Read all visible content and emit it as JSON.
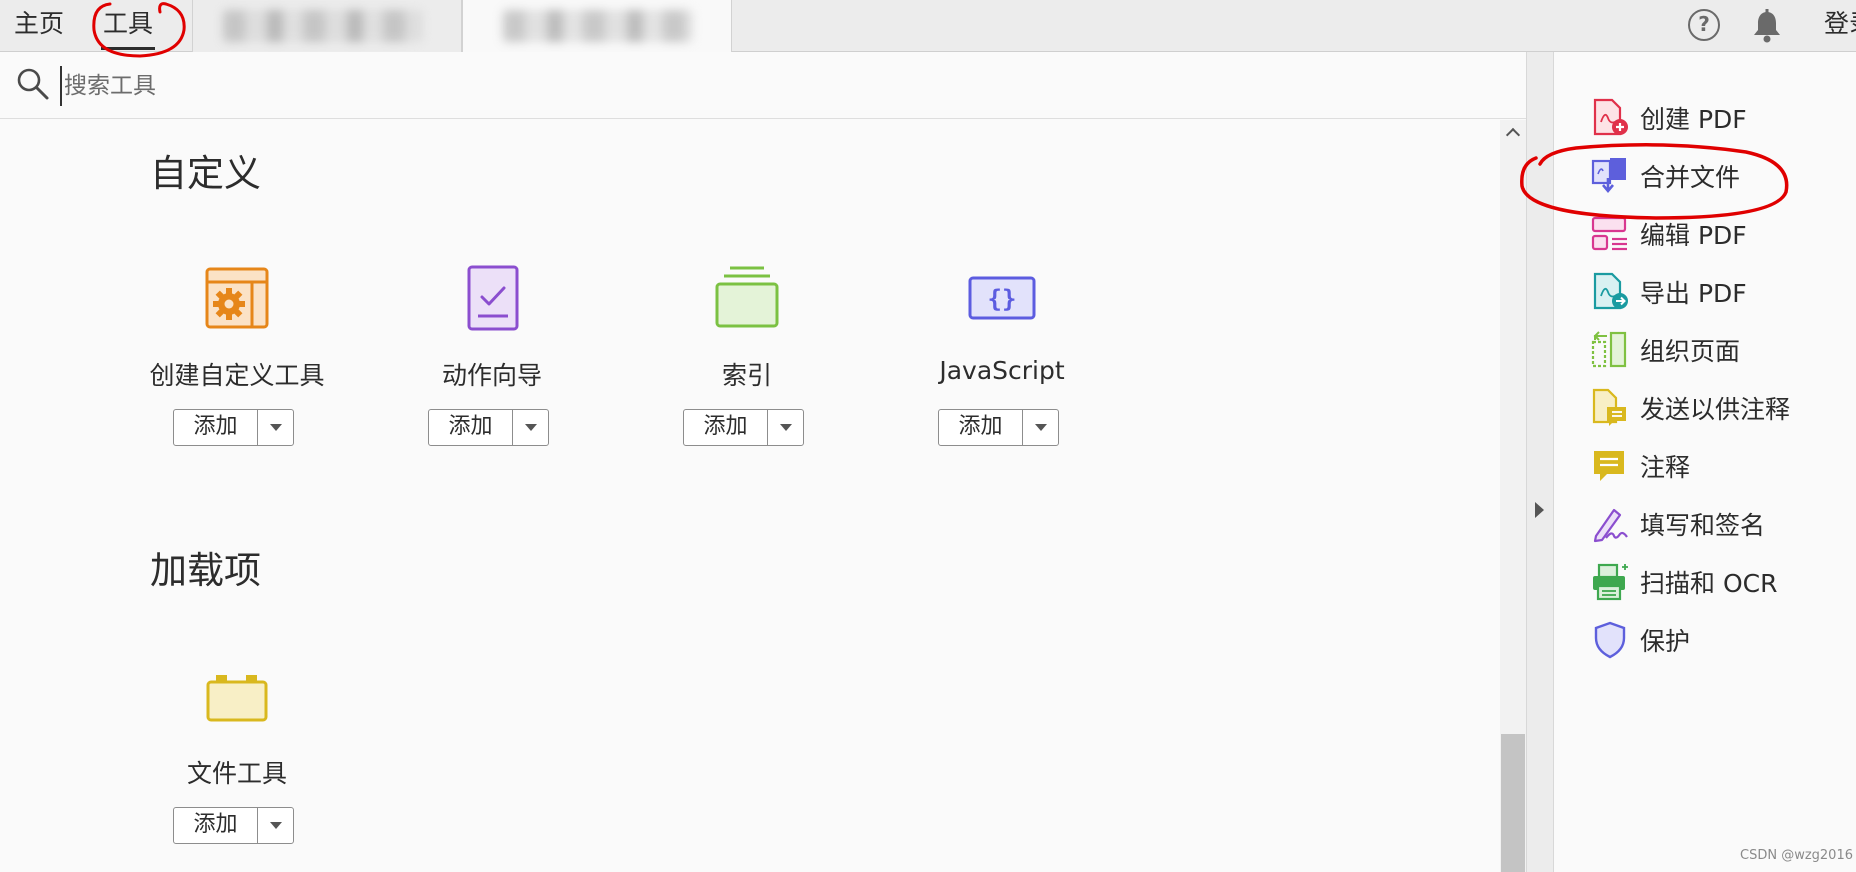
{
  "nav": {
    "home_label": "主页",
    "tools_label": "工具",
    "login_label": "登录"
  },
  "search": {
    "placeholder": "搜索工具"
  },
  "sections": {
    "custom_title": "自定义",
    "addons_title": "加载项"
  },
  "custom_tools": [
    {
      "label": "创建自定义工具",
      "icon": "custom-tool-icon",
      "color": "#e68619"
    },
    {
      "label": "动作向导",
      "icon": "action-wizard-icon",
      "color": "#8b4ecf"
    },
    {
      "label": "索引",
      "icon": "index-icon",
      "color": "#7bc142"
    },
    {
      "label": "JavaScript",
      "icon": "javascript-icon",
      "color": "#5c5ce0"
    }
  ],
  "addon_tools": [
    {
      "label": "文件工具",
      "icon": "file-tool-icon",
      "color": "#d9b81e"
    }
  ],
  "add_button_label": "添加",
  "right_panel": {
    "items": [
      {
        "label": "创建 PDF",
        "icon": "create-pdf-icon",
        "color": "#e0314a"
      },
      {
        "label": "合并文件",
        "icon": "combine-files-icon",
        "color": "#5d5fdc"
      },
      {
        "label": "编辑 PDF",
        "icon": "edit-pdf-icon",
        "color": "#d83790"
      },
      {
        "label": "导出 PDF",
        "icon": "export-pdf-icon",
        "color": "#1a9ba1"
      },
      {
        "label": "组织页面",
        "icon": "organize-pages-icon",
        "color": "#7fc141"
      },
      {
        "label": "发送以供注释",
        "icon": "send-comment-icon",
        "color": "#d9b81e"
      },
      {
        "label": "注释",
        "icon": "comment-icon",
        "color": "#d9b81e"
      },
      {
        "label": "填写和签名",
        "icon": "fill-sign-icon",
        "color": "#8b4ecf"
      },
      {
        "label": "扫描和 OCR",
        "icon": "scan-ocr-icon",
        "color": "#3ea84f"
      },
      {
        "label": "保护",
        "icon": "protect-icon",
        "color": "#5d5fdc"
      }
    ]
  },
  "watermark": "CSDN @wzg2016",
  "annotation_color": "#e00000"
}
